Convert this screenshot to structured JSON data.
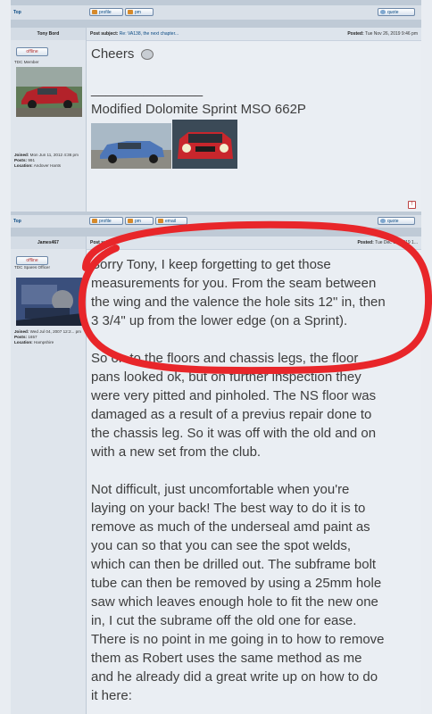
{
  "top_bar": {
    "top_link": "Top",
    "profile_label": "profile",
    "pm_label": "pm",
    "quote_label": "quote"
  },
  "post1": {
    "author": "Tony Bord",
    "status": "offline",
    "rank": "TDC Member",
    "joined_label": "Joined:",
    "joined": "Mon Jun 11, 2012 4:36 pm",
    "posts_label": "Posts:",
    "posts": "991",
    "location_label": "Location:",
    "location": "Andover Hants",
    "subject_label": "Post subject:",
    "subject": "Re: VA138, the next chapter...",
    "posted_label": "Posted:",
    "posted": "Tue Nov 26, 2019 9:46 pm",
    "body_line1": "Cheers",
    "signature_rule": "_______________",
    "signature": "Modified Dolomite Sprint MSO 662P"
  },
  "post1_bottom": {
    "top_link": "Top",
    "profile_label": "profile",
    "pm_label": "pm",
    "email_label": "email",
    "quote_label": "quote"
  },
  "post2": {
    "author": "James467",
    "status": "offline",
    "rank": "TDC Spares Officer",
    "joined_label": "Joined:",
    "joined": "Wed Jul 04, 2007 12:2... pm",
    "posts_label": "Posts:",
    "posts": "1657",
    "location_label": "Location:",
    "location": "Hampshire",
    "subject_label": "Post subject:",
    "posted_label": "Posted:",
    "posted": "Tue Dec 10, 2019 1...",
    "paragraphs": [
      [
        "Sorry Tony, I keep forgetting to get those",
        "measurements for you. From the seam between",
        "the wing and the valence the hole sits 12\" in, then",
        "3 3/4\" up from the lower edge (on a Sprint)."
      ],
      [
        "So on to the floors and chassis legs, the floor",
        "pans looked ok, but on further inspection they",
        "were very pitted and pinholed. The NS floor was",
        "damaged as a result of a previus repair done to",
        "the chassis leg. So it was off with the old and on",
        "with a new set from the club."
      ],
      [
        "Not difficult, just uncomfortable when you're",
        "laying on your back! The best way to do it is to",
        "remove as much of the underseal amd paint as",
        "you can so that you can see the spot welds,",
        "which can then be drilled out. The subframe bolt",
        "tube can then be removed by using a 25mm hole",
        "saw which leaves enough hole to fit the new one",
        "in, I cut the subrame off the old one for ease.",
        "There is no point in me going in to how to remove",
        "them as Robert uses the same method as me",
        "and he already did a great write up on how to do",
        "it here:"
      ]
    ]
  },
  "colors": {
    "highlight_circle": "#e8262a",
    "link": "#0b4a83",
    "offline": "#b03030"
  }
}
